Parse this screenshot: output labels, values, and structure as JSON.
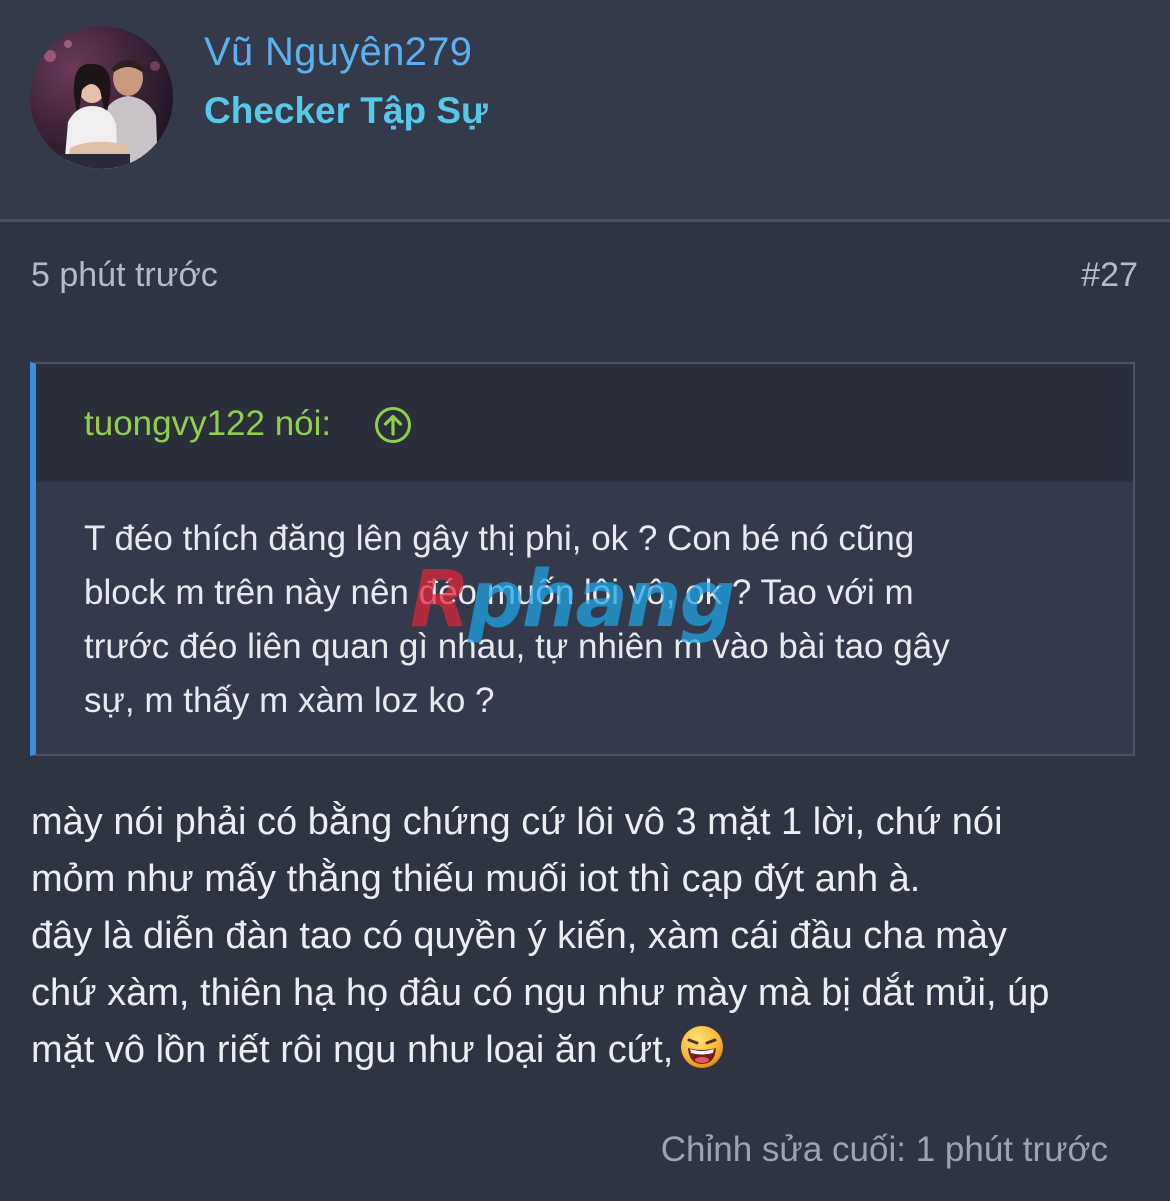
{
  "author": {
    "username": "Vũ Nguyên279",
    "title": "Checker Tập Sự"
  },
  "post": {
    "time": "5 phút trước",
    "number": "#27",
    "edited": "Chỉnh sửa cuối: 1 phút trước"
  },
  "quote": {
    "author_label": "tuongvy122 nói:",
    "lines": [
      "T đéo thích đăng lên gây thị phi, ok ? Con bé nó cũng",
      "block m trên này nên đéo muốn lôi vô, ok ? Tao với m",
      "trước đéo liên quan gì nhau, tự nhiên m vào bài tao gây",
      "sự, m thấy m xàm loz ko ?"
    ]
  },
  "message": {
    "line1": "mày nói phải có bằng chứng cứ lôi vô 3 mặt 1 lời, chứ nói",
    "line2": "mỏm như mấy thằng thiếu muối iot thì cạp đýt anh à.",
    "line3": "đây là diễn đàn tao có quyền ý kiến, xàm cái đầu cha mày",
    "line4": "chứ xàm, thiên hạ họ đâu có ngu như mày mà bị dắt mủi, úp",
    "line5": "mặt vô lồn riết rôi ngu như loại ăn cứt,"
  },
  "watermark": {
    "part1": "R",
    "part2": "phang"
  },
  "icons": {
    "avatar": "avatar-photo",
    "quote_jump": "arrow-up-circle-icon",
    "emoji": "laughing-emoji-icon"
  },
  "colors": {
    "username": "#5ab0f0",
    "title": "#56c8e8",
    "quote_author": "#8fd04a",
    "quote_bar": "#3a8fe0"
  }
}
